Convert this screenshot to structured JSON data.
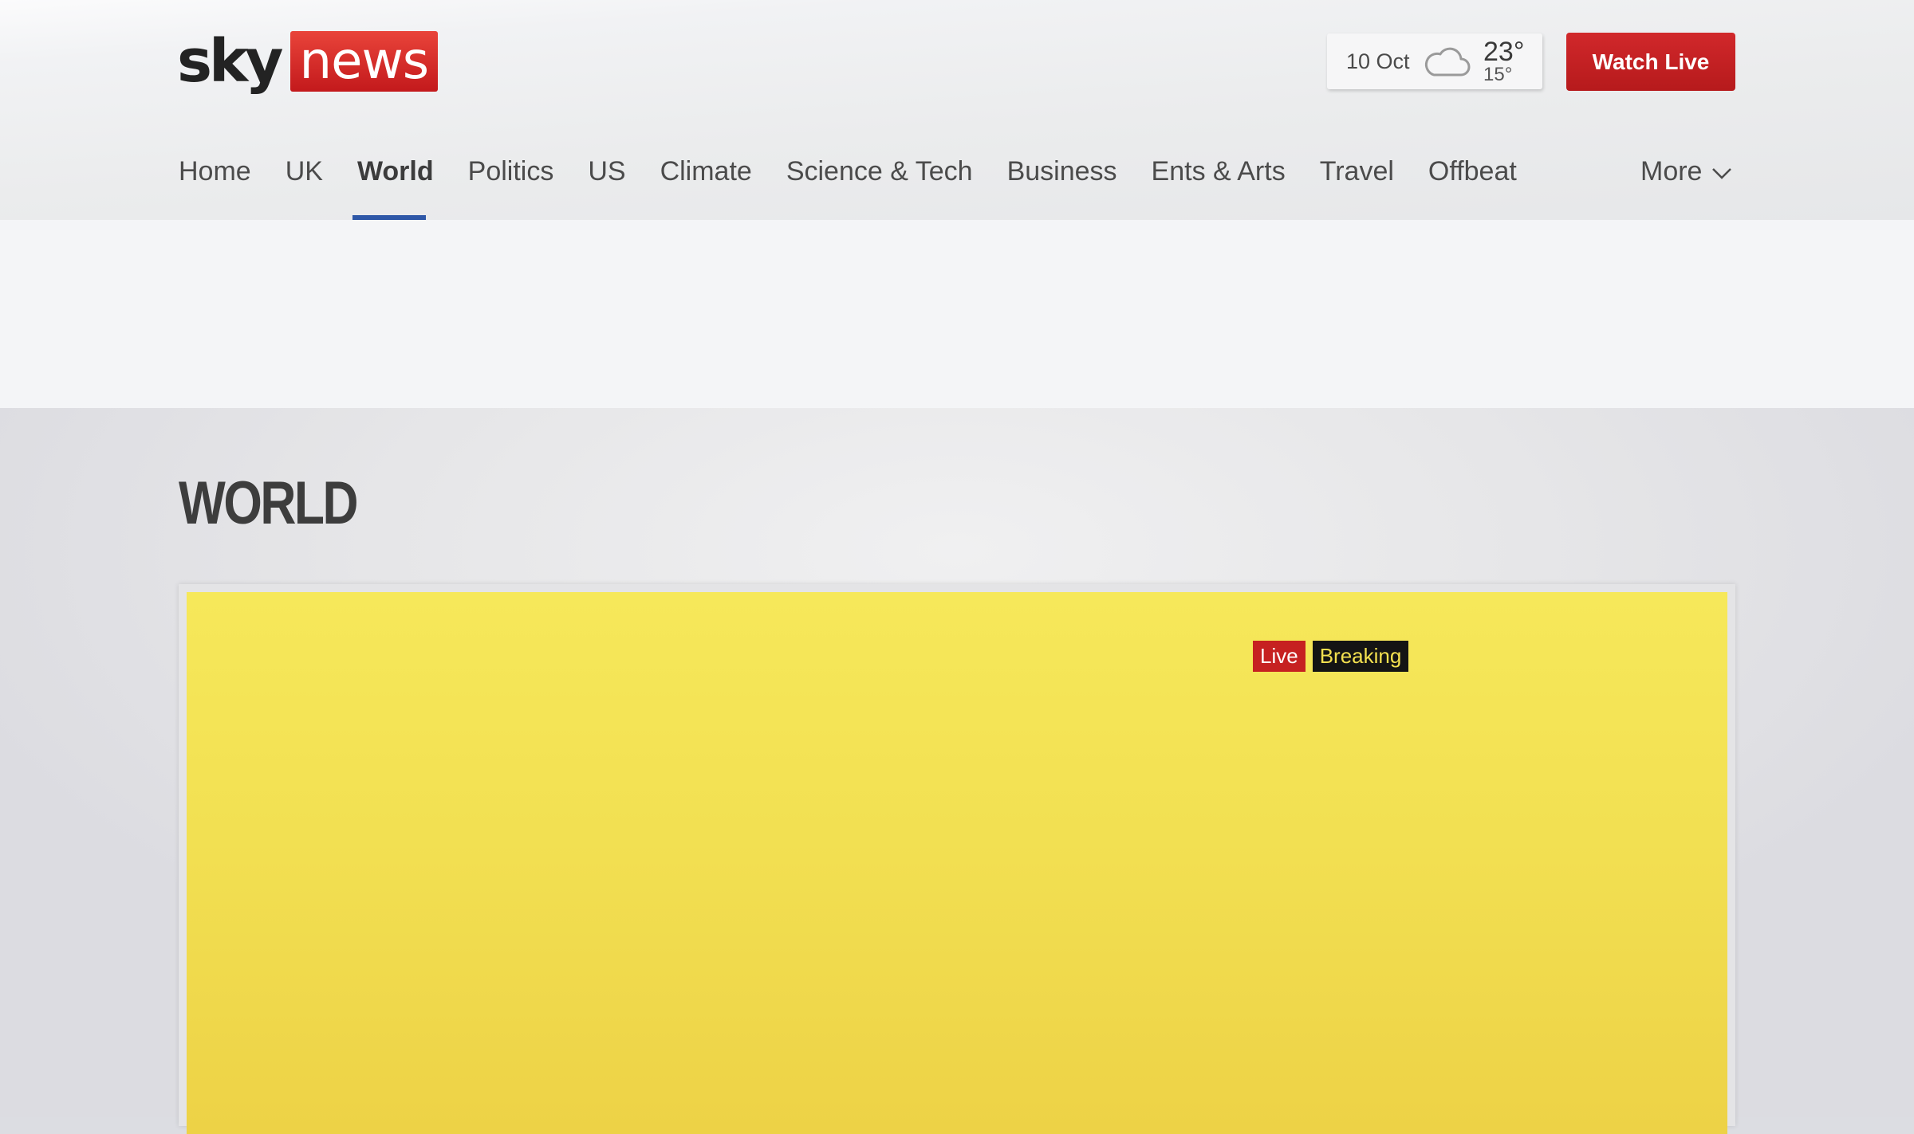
{
  "brand": {
    "logo_sky": "sky",
    "logo_news": "news",
    "accent": "#c62121"
  },
  "weather": {
    "date": "10 Oct",
    "icon": "cloud-icon",
    "high": "23°",
    "low": "15°"
  },
  "header": {
    "watch_live_label": "Watch Live"
  },
  "nav": {
    "items": [
      {
        "label": "Home"
      },
      {
        "label": "UK"
      },
      {
        "label": "World",
        "active": true
      },
      {
        "label": "Politics"
      },
      {
        "label": "US"
      },
      {
        "label": "Climate"
      },
      {
        "label": "Science & Tech"
      },
      {
        "label": "Business"
      },
      {
        "label": "Ents & Arts"
      },
      {
        "label": "Travel"
      },
      {
        "label": "Offbeat"
      }
    ],
    "more_label": "More",
    "active_color": "#2e57a7"
  },
  "page": {
    "title": "WORLD"
  },
  "hero": {
    "badge_live": "Live",
    "badge_breaking": "Breaking",
    "background_color": "#f2e052"
  }
}
